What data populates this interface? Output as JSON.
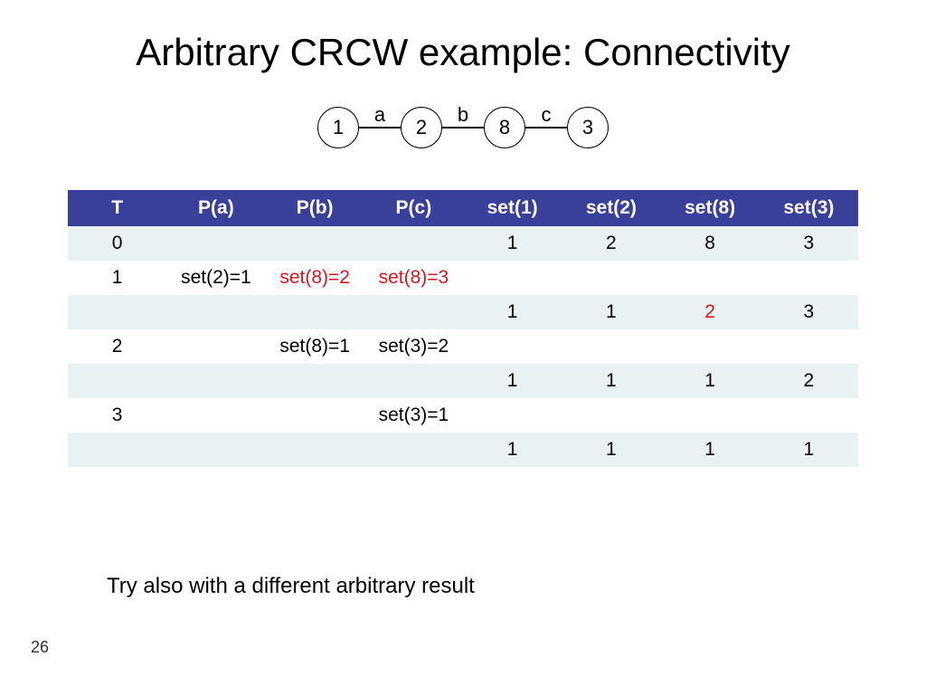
{
  "title": "Arbitrary CRCW example: Connectivity",
  "graph": {
    "nodes": [
      "1",
      "2",
      "8",
      "3"
    ],
    "edges": [
      "a",
      "b",
      "c"
    ]
  },
  "table": {
    "headers": [
      "T",
      "P(a)",
      "P(b)",
      "P(c)",
      "set(1)",
      "set(2)",
      "set(8)",
      "set(3)"
    ],
    "rows": [
      {
        "band": true,
        "cells": [
          {
            "t": "0"
          },
          {
            "t": ""
          },
          {
            "t": ""
          },
          {
            "t": ""
          },
          {
            "t": "1"
          },
          {
            "t": "2"
          },
          {
            "t": "8"
          },
          {
            "t": "3"
          }
        ]
      },
      {
        "band": false,
        "cells": [
          {
            "t": "1"
          },
          {
            "t": "set(2)=1"
          },
          {
            "t": "set(8)=2",
            "red": true
          },
          {
            "t": "set(8)=3",
            "red": true
          },
          {
            "t": ""
          },
          {
            "t": ""
          },
          {
            "t": ""
          },
          {
            "t": ""
          }
        ]
      },
      {
        "band": true,
        "cells": [
          {
            "t": ""
          },
          {
            "t": ""
          },
          {
            "t": ""
          },
          {
            "t": ""
          },
          {
            "t": "1"
          },
          {
            "t": "1"
          },
          {
            "t": "2",
            "red": true
          },
          {
            "t": "3"
          }
        ]
      },
      {
        "band": false,
        "cells": [
          {
            "t": "2"
          },
          {
            "t": ""
          },
          {
            "t": "set(8)=1"
          },
          {
            "t": "set(3)=2"
          },
          {
            "t": ""
          },
          {
            "t": ""
          },
          {
            "t": ""
          },
          {
            "t": ""
          }
        ]
      },
      {
        "band": true,
        "cells": [
          {
            "t": ""
          },
          {
            "t": ""
          },
          {
            "t": ""
          },
          {
            "t": ""
          },
          {
            "t": "1"
          },
          {
            "t": "1"
          },
          {
            "t": "1"
          },
          {
            "t": "2"
          }
        ]
      },
      {
        "band": false,
        "cells": [
          {
            "t": "3"
          },
          {
            "t": ""
          },
          {
            "t": ""
          },
          {
            "t": "set(3)=1"
          },
          {
            "t": ""
          },
          {
            "t": ""
          },
          {
            "t": ""
          },
          {
            "t": ""
          }
        ]
      },
      {
        "band": true,
        "cells": [
          {
            "t": ""
          },
          {
            "t": ""
          },
          {
            "t": ""
          },
          {
            "t": ""
          },
          {
            "t": "1"
          },
          {
            "t": "1"
          },
          {
            "t": "1"
          },
          {
            "t": "1"
          }
        ]
      }
    ]
  },
  "footnote": "Try also with a different arbitrary result",
  "page_number": "26"
}
